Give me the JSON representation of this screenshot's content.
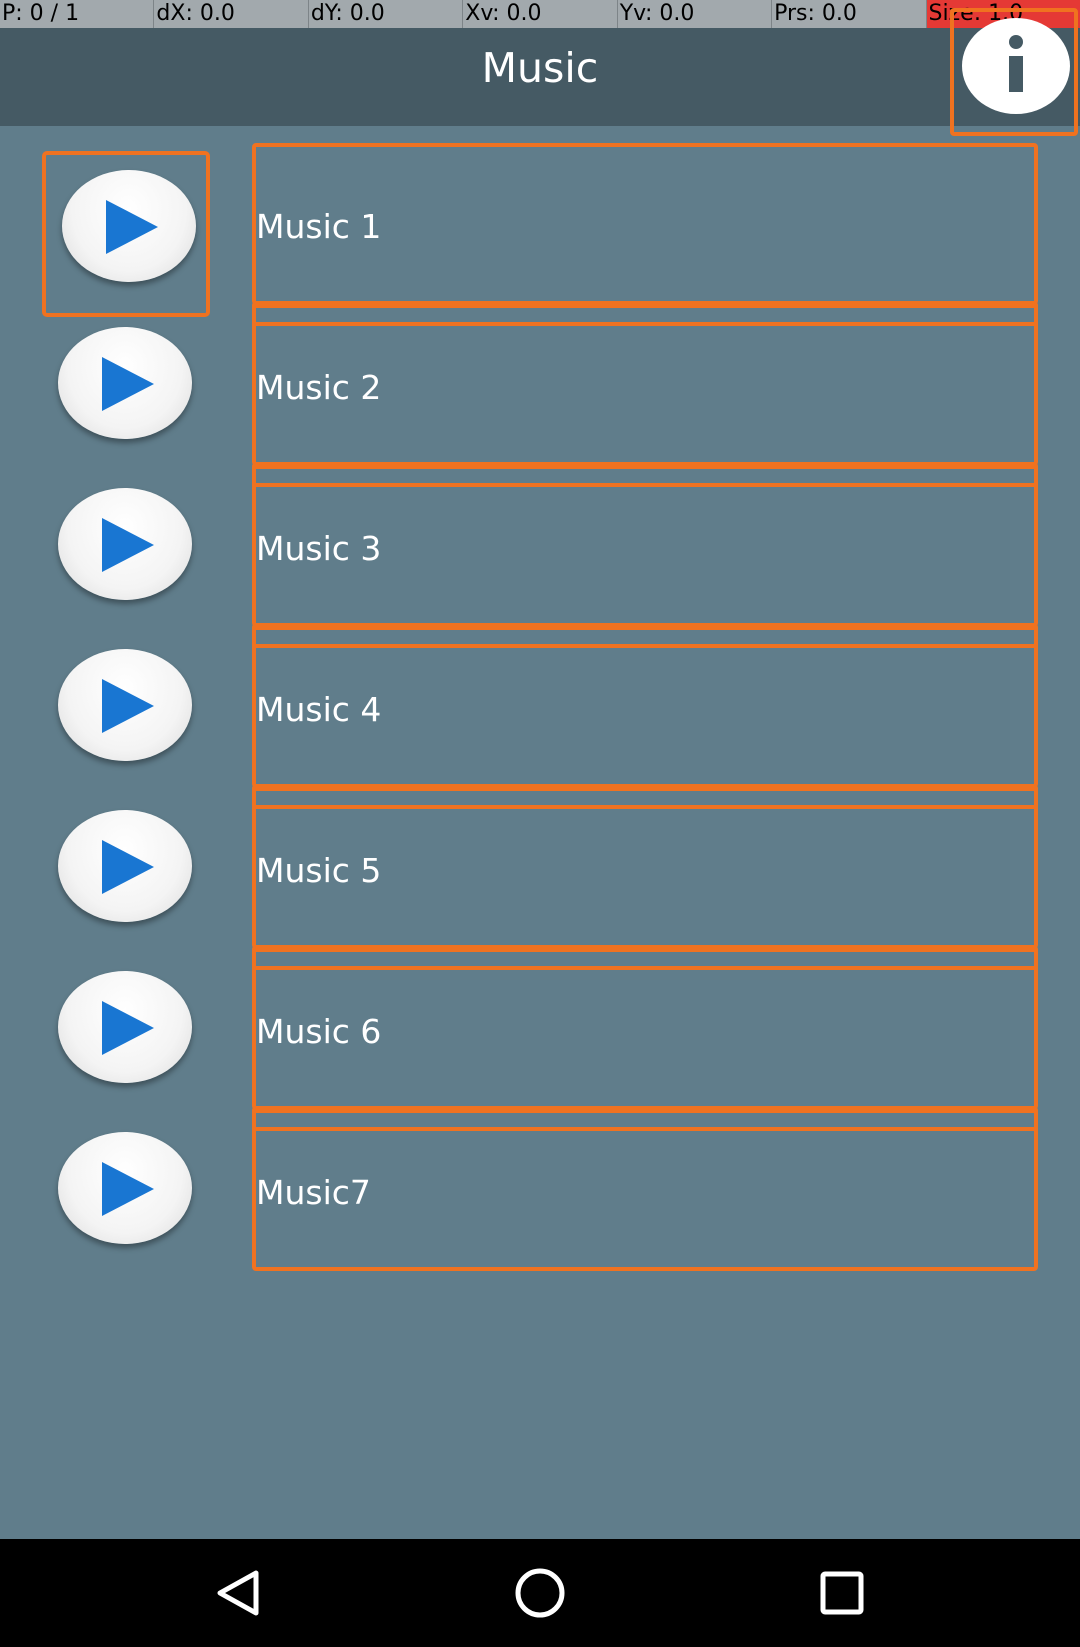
{
  "debug_bar": {
    "pointer": "P: 0 / 1",
    "dx": "dX: 0.0",
    "dy": "dY: 0.0",
    "xv": "Xv: 0.0",
    "yv": "Yv: 0.0",
    "prs": "Prs: 0.0",
    "size": "Size: 1.0"
  },
  "toolbar": {
    "title": "Music",
    "info_icon": "info-icon"
  },
  "tracks": [
    {
      "title": "Music 1",
      "icon": "play-icon"
    },
    {
      "title": "Music 2",
      "icon": "play-icon"
    },
    {
      "title": "Music 3",
      "icon": "play-icon"
    },
    {
      "title": "Music 4",
      "icon": "play-icon"
    },
    {
      "title": "Music 5",
      "icon": "play-icon"
    },
    {
      "title": "Music 6",
      "icon": "play-icon"
    },
    {
      "title": "Music7",
      "icon": "play-icon"
    }
  ],
  "navbar": {
    "back_icon": "back-triangle-icon",
    "home_icon": "home-circle-icon",
    "recents_icon": "recents-square-icon"
  },
  "colors": {
    "background": "#607d8b",
    "toolbar": "#455a64",
    "highlight": "#f07220",
    "play_accent": "#1976d2"
  }
}
